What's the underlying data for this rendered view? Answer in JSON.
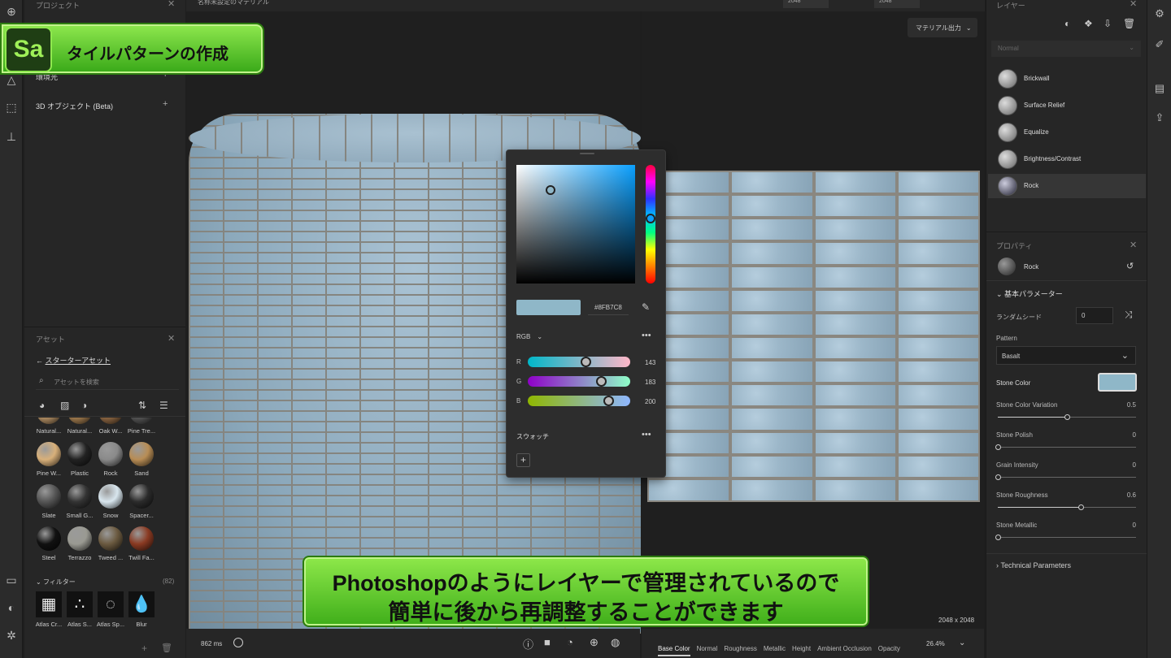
{
  "app_badge": {
    "logo": "Sa",
    "title": "タイルパターンの作成"
  },
  "caption": {
    "line1": "Photoshopのようにレイヤーで管理されているので",
    "line2": "簡単に後から再調整することができます"
  },
  "topbar": {
    "doc_title": "名称未設定のマテリアル",
    "width_value": "2048",
    "height_value": "2048"
  },
  "left_panel": {
    "project_header": "プロジェクト",
    "environment_label": "環境光",
    "object_label": "3D オブジェクト (Beta)",
    "assets_header": "アセット",
    "starter_assets_link": "スターターアセット",
    "search_placeholder": "アセットを検索",
    "materials": [
      {
        "label": "Natural...",
        "color": "#b08d63"
      },
      {
        "label": "Natural...",
        "color": "#a07b4e"
      },
      {
        "label": "Oak W...",
        "color": "#8c6642"
      },
      {
        "label": "Pine Tre...",
        "color": "#555"
      },
      {
        "label": "Pine W...",
        "color": "#d8b07a"
      },
      {
        "label": "Plastic",
        "color": "#222"
      },
      {
        "label": "Rock",
        "color": "#8a8a8a"
      },
      {
        "label": "Sand",
        "color": "#b88d55"
      },
      {
        "label": "Slate",
        "color": "#555"
      },
      {
        "label": "Small G...",
        "color": "#333"
      },
      {
        "label": "Snow",
        "color": "#d8e6ee"
      },
      {
        "label": "Spacer...",
        "color": "#2b2b2b"
      },
      {
        "label": "Steel",
        "color": "#111"
      },
      {
        "label": "Terrazzo",
        "color": "#9a9a92"
      },
      {
        "label": "Tweed ...",
        "color": "#6b5a40"
      },
      {
        "label": "Twill Fa...",
        "color": "#8a3a22"
      }
    ],
    "filters_label": "フィルター",
    "filters_count": "(82)",
    "filters": [
      {
        "label": "Atlas Cr..."
      },
      {
        "label": "Atlas S..."
      },
      {
        "label": "Atlas Sp..."
      },
      {
        "label": "Blur"
      }
    ]
  },
  "viewport": {
    "export_button": "マテリアル出力",
    "render_time": "862 ms",
    "resolution": "2048 x 2048",
    "zoom": "26.4%",
    "channels": [
      "Base Color",
      "Normal",
      "Roughness",
      "Metallic",
      "Height",
      "Ambient Occlusion",
      "Opacity"
    ]
  },
  "color_picker": {
    "hex": "#8FB7C8",
    "mode": "RGB",
    "r": 143,
    "g": 183,
    "b": 200,
    "r_label": "R",
    "g_label": "G",
    "b_label": "B",
    "swatches_label": "スウォッチ",
    "add_symbol": "+"
  },
  "right_panel": {
    "layers_header": "レイヤー",
    "blend_mode": "Normal",
    "layers": [
      {
        "label": "Brickwall"
      },
      {
        "label": "Surface Relief"
      },
      {
        "label": "Equalize"
      },
      {
        "label": "Brightness/Contrast"
      },
      {
        "label": "Rock"
      }
    ],
    "properties_header": "プロパティ",
    "selected_layer": "Rock",
    "basic_params_label": "基本パラメーター",
    "random_seed_label": "ランダムシード",
    "random_seed_value": "0",
    "pattern_label": "Pattern",
    "pattern_value": "Basalt",
    "stone_color_label": "Stone Color",
    "stone_color": "#8FB7C8",
    "params": [
      {
        "label": "Stone Color Variation",
        "value": "0.5",
        "fraction": 0.5
      },
      {
        "label": "Stone Polish",
        "value": "0",
        "fraction": 0
      },
      {
        "label": "Grain Intensity",
        "value": "0",
        "fraction": 0
      },
      {
        "label": "Stone Roughness",
        "value": "0.6",
        "fraction": 0.6
      },
      {
        "label": "Stone Metallic",
        "value": "0",
        "fraction": 0
      }
    ],
    "technical_label": "Technical Parameters"
  }
}
